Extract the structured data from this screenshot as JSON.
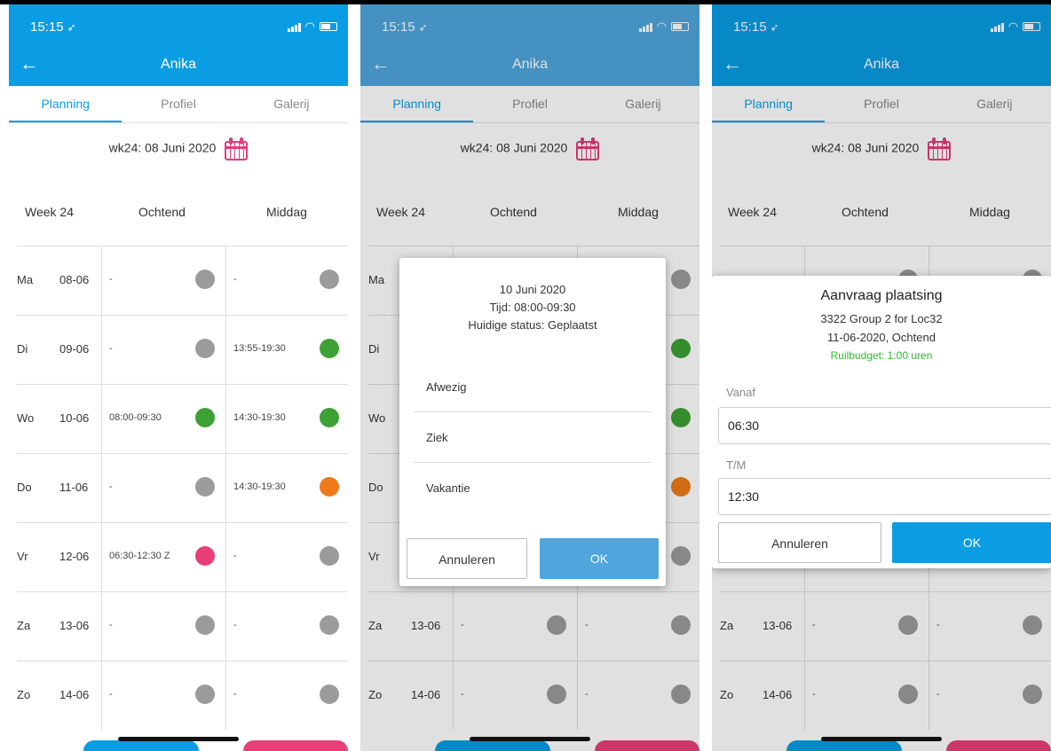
{
  "status": {
    "time": "15:15"
  },
  "header": {
    "title": "Anika"
  },
  "tabs": [
    "Planning",
    "Profiel",
    "Galerij"
  ],
  "week_label": "wk24: 08 Juni 2020",
  "columns": {
    "week": "Week 24",
    "morning": "Ochtend",
    "afternoon": "Middag"
  },
  "rows": [
    {
      "day": "Ma",
      "date": "08-06",
      "morning": "-",
      "afternoon": "-",
      "morning_color": "#9b9b9b",
      "afternoon_color": "#9b9b9b"
    },
    {
      "day": "Di",
      "date": "09-06",
      "morning": "-",
      "afternoon": "13:55-19:30",
      "morning_color": "#9b9b9b",
      "afternoon_color": "#3da135"
    },
    {
      "day": "Wo",
      "date": "10-06",
      "morning": "08:00-09:30",
      "afternoon": "14:30-19:30",
      "morning_color": "#3da135",
      "afternoon_color": "#3da135"
    },
    {
      "day": "Do",
      "date": "11-06",
      "morning": "-",
      "afternoon": "14:30-19:30",
      "morning_color": "#9b9b9b",
      "afternoon_color": "#f07a1a"
    },
    {
      "day": "Vr",
      "date": "12-06",
      "morning": "06:30-12:30 Z",
      "afternoon": "-",
      "morning_color": "#e83e7a",
      "afternoon_color": "#9b9b9b"
    },
    {
      "day": "Za",
      "date": "13-06",
      "morning": "-",
      "afternoon": "-",
      "morning_color": "#9b9b9b",
      "afternoon_color": "#9b9b9b"
    },
    {
      "day": "Zo",
      "date": "14-06",
      "morning": "-",
      "afternoon": "-",
      "morning_color": "#9b9b9b",
      "afternoon_color": "#9b9b9b"
    }
  ],
  "status_dialog": {
    "date": "10 Juni 2020",
    "time": "Tijd: 08:00-09:30",
    "status": "Huidige status: Geplaatst",
    "options": [
      "Afwezig",
      "Ziek",
      "Vakantie"
    ],
    "cancel": "Annuleren",
    "ok": "OK"
  },
  "request_dialog": {
    "title": "Aanvraag plaatsing",
    "group": "3322 Group 2 for Loc32",
    "slot": "11-06-2020, Ochtend",
    "budget": "Ruilbudget: 1:00 uren",
    "from_label": "Vanaf",
    "from_value": "06:30",
    "to_label": "T/M",
    "to_value": "12:30",
    "cancel": "Annuleren",
    "ok": "OK"
  },
  "icons": [
    "back-arrow-icon",
    "location-arrow-icon",
    "signal-icon",
    "wifi-icon",
    "battery-icon",
    "calendar-icon"
  ]
}
